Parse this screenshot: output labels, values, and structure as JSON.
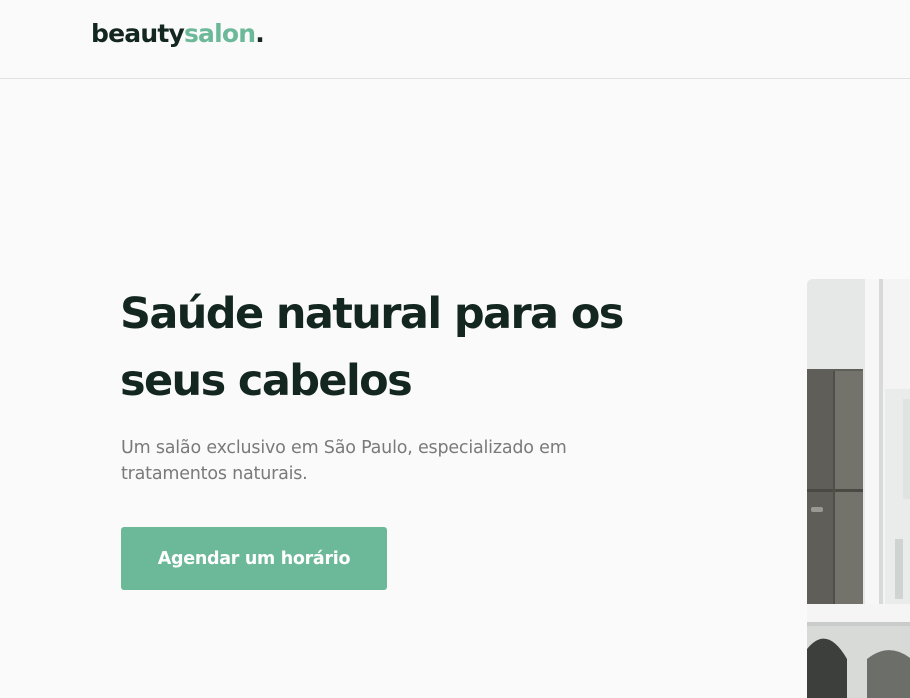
{
  "header": {
    "logo": {
      "part1": "beauty",
      "part2": "salon",
      "dot": "."
    }
  },
  "hero": {
    "title": "Saúde natural para os seus cabelos",
    "subtitle": "Um salão exclusivo em São Paulo, especializado em tratamentos naturais.",
    "cta_label": "Agendar um horário",
    "photo_alt": "salon-interior-photo"
  },
  "colors": {
    "background": "#fafafa",
    "text_dark": "#13261f",
    "accent": "#6cb99a",
    "muted_text": "#7a7a7a",
    "button_text": "#ffffff"
  }
}
